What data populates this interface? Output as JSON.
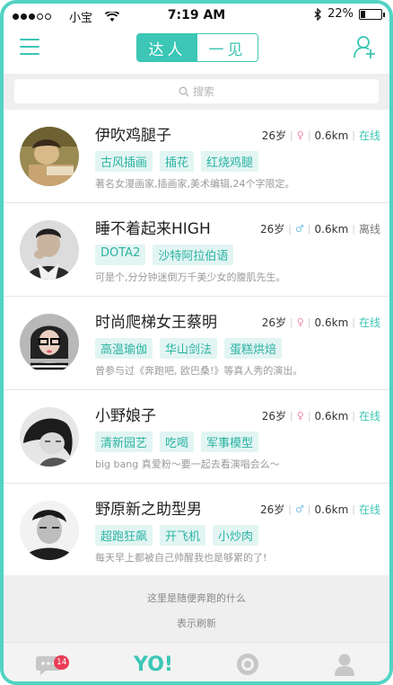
{
  "status_bar": {
    "carrier": "小宝",
    "time": "7:19 AM",
    "battery": "22%"
  },
  "nav": {
    "tab_active": "达人",
    "tab_inactive": "一见"
  },
  "search": {
    "placeholder": "搜索"
  },
  "people": [
    {
      "name": "伊吹鸡腿子",
      "age": "26岁",
      "gender": "female",
      "gender_symbol": "♀",
      "distance": "0.6km",
      "status": "在线",
      "online": true,
      "tags": [
        "古风插画",
        "插花",
        "红烧鸡腿"
      ],
      "desc": "著名女漫画家,插画家,美术编辑,24个字限定。"
    },
    {
      "name": "睡不着起来HIGH",
      "age": "26岁",
      "gender": "male",
      "gender_symbol": "♂",
      "distance": "0.6km",
      "status": "离线",
      "online": false,
      "tags": [
        "DOTA2",
        "沙特阿拉伯语"
      ],
      "desc": "可是个,分分钟迷倒万千美少女的腹肌先生。"
    },
    {
      "name": "时尚爬梯女王蔡明",
      "age": "26岁",
      "gender": "female",
      "gender_symbol": "♀",
      "distance": "0.6km",
      "status": "在线",
      "online": true,
      "tags": [
        "高温瑜伽",
        "华山剑法",
        "蛋糕烘焙"
      ],
      "desc": "曾参与过《奔跑吧, 欧巴桑!》等真人秀的演出。"
    },
    {
      "name": "小野娘子",
      "age": "26岁",
      "gender": "female",
      "gender_symbol": "♀",
      "distance": "0.6km",
      "status": "在线",
      "online": true,
      "tags": [
        "清新园艺",
        "吃喝",
        "军事模型"
      ],
      "desc": "big bang 真爱粉～要一起去看演唱会么～"
    },
    {
      "name": "野原新之助型男",
      "age": "26岁",
      "gender": "male",
      "gender_symbol": "♂",
      "distance": "0.6km",
      "status": "在线",
      "online": true,
      "tags": [
        "超跑狂飙",
        "开飞机",
        "小炒肉"
      ],
      "desc": "每天早上都被自己帅醒我也是够累的了!"
    }
  ],
  "footer": {
    "line1": "这里是随便奔跑的什么",
    "line2": "表示刷新"
  },
  "tabbar": {
    "messages_badge": "14",
    "yo_label": "YO!"
  },
  "colors": {
    "accent": "#3bc6b5",
    "frame": "#52d3c3",
    "badge": "#ea3c57",
    "female": "#f08aa8",
    "male": "#7ec4e8"
  }
}
